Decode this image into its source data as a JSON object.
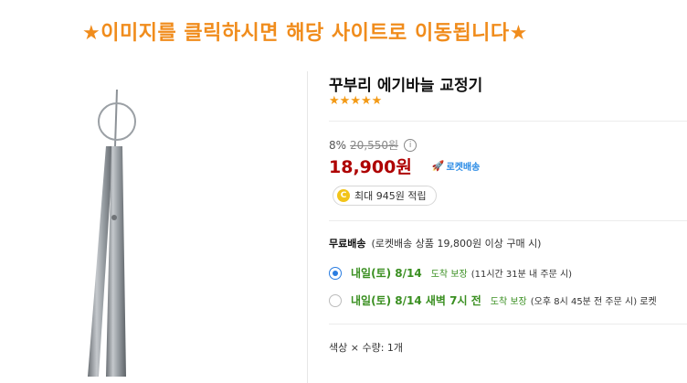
{
  "banner": {
    "text": "★이미지를 클릭하시면 해당 사이트로 이동됩니다★"
  },
  "product": {
    "title": "꾸부리 에기바늘 교정기",
    "rating_stars": 5,
    "discount_rate": "8%",
    "original_price": "20,550원",
    "info_icon": "ⓘ",
    "price": "18,900원",
    "rocket_label": "로켓배송",
    "points_icon": "C",
    "points_text": "최대 945원 적립"
  },
  "shipping": {
    "label": "무료배송",
    "condition": "(로켓배송 상품 19,800원 이상 구매 시)",
    "options": [
      {
        "selected": true,
        "date": "내일(토) 8/14",
        "type": "도착 보장",
        "note": "(11시간 31분 내 주문 시)"
      },
      {
        "selected": false,
        "date": "내일(토) 8/14 새벽 7시 전",
        "type": "도착 보장",
        "note": "(오후 8시 45분 전 주문 시)  로켓"
      }
    ]
  },
  "selection": {
    "text": "색상 × 수량: 1개"
  },
  "colors": {
    "price": "#ae0000",
    "banner": "#f08c1c",
    "green": "#3a8f21",
    "accent": "#2a7de1"
  }
}
